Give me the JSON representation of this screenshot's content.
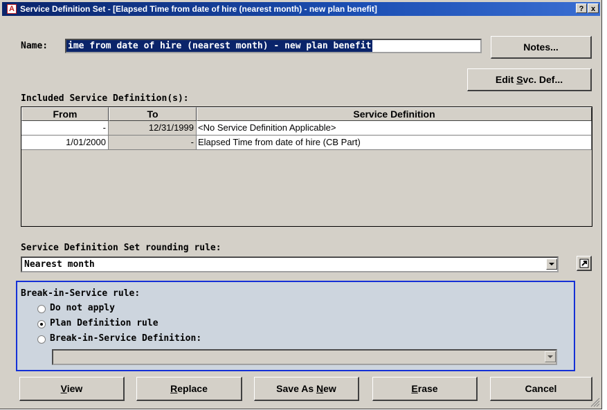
{
  "window": {
    "title": "Service Definition Set - [Elapsed Time from date of hire (nearest month) - new plan benefit]",
    "help_btn": "?",
    "close_btn": "x"
  },
  "name": {
    "label": "Name:",
    "value": "ime from date of hire (nearest month) - new plan benefit"
  },
  "buttons": {
    "notes": "Notes...",
    "edit_svc_def": "Edit Svc. Def..."
  },
  "included": {
    "label": "Included Service Definition(s):",
    "columns": [
      "From",
      "To",
      "Service Definition"
    ],
    "rows": [
      {
        "from": "-",
        "to": "12/31/1999",
        "definition": "<No Service Definition Applicable>"
      },
      {
        "from": "1/01/2000",
        "to": "-",
        "definition": "Elapsed Time from date of hire (CB Part)"
      }
    ]
  },
  "rounding": {
    "label": "Service Definition Set rounding rule:",
    "value": "Nearest month",
    "link_icon": "open-link-icon"
  },
  "bis": {
    "label": "Break-in-Service rule:",
    "options": [
      "Do not apply",
      "Plan Definition rule",
      "Break-in-Service Definition:"
    ],
    "selected": "Plan Definition rule",
    "definition_value": ""
  },
  "footer": {
    "view": "View",
    "replace": "Replace",
    "save_as_new": "Save As New",
    "erase": "Erase",
    "cancel": "Cancel"
  },
  "colors": {
    "titlebar": "#0a246a",
    "group_border": "#1430d6",
    "group_bg": "#cdd5de"
  }
}
